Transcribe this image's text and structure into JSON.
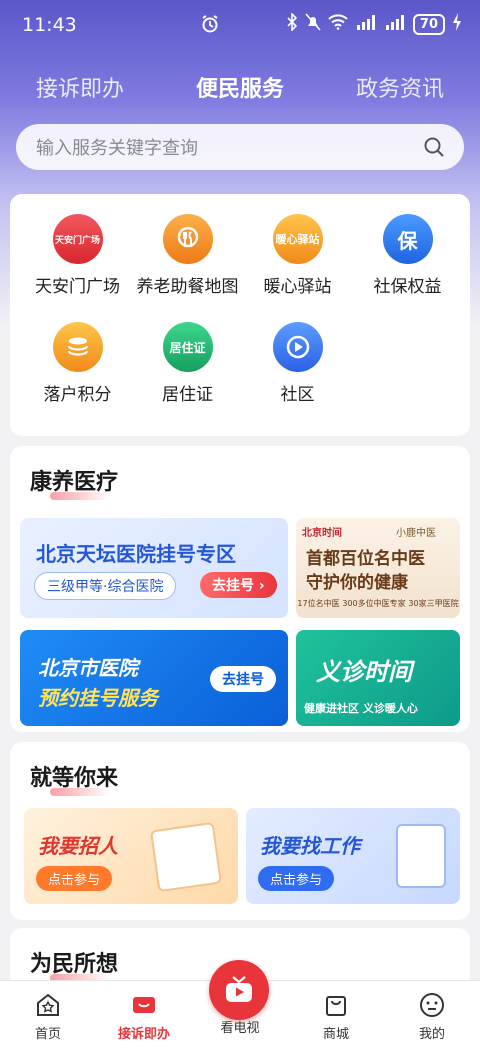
{
  "status": {
    "time": "11:43",
    "battery": "70"
  },
  "tabs": [
    {
      "label": "接诉即办"
    },
    {
      "label": "便民服务"
    },
    {
      "label": "政务资讯"
    }
  ],
  "search": {
    "placeholder": "输入服务关键字查询"
  },
  "services": [
    {
      "label": "天安门广场",
      "icon": "tiananmen-icon",
      "icon_text": "天安门广场",
      "color": "#e8353c"
    },
    {
      "label": "养老助餐地图",
      "icon": "meal-icon",
      "icon_text": "",
      "color": "#f08a24"
    },
    {
      "label": "暖心驿站",
      "icon": "warm-station-icon",
      "icon_text": "暖心驿站",
      "color": "#f5a623"
    },
    {
      "label": "社保权益",
      "icon": "insurance-icon",
      "icon_text": "保",
      "color": "#2f7ff0"
    },
    {
      "label": "落户积分",
      "icon": "points-icon",
      "icon_text": "",
      "color": "#f5a623"
    },
    {
      "label": "居住证",
      "icon": "residence-card-icon",
      "icon_text": "居住证",
      "color": "#22b573"
    },
    {
      "label": "社区",
      "icon": "community-icon",
      "icon_text": "",
      "color": "#3a7bf0"
    }
  ],
  "health": {
    "title": "康养医疗",
    "banner1": {
      "title": "北京天坛医院挂号专区",
      "subtitle": "三级甲等·综合医院",
      "button": "去挂号"
    },
    "banner2": {
      "brand": "北京时间",
      "partner": "小鹿中医",
      "line1": "首都百位名中医",
      "line2": "守护你的健康",
      "tags": [
        "17位名中医",
        "300多位中医专家",
        "30家三甲医院"
      ]
    },
    "banner3": {
      "line1": "北京市医院",
      "line2": "预约挂号服务",
      "button": "去挂号"
    },
    "banner4": {
      "title": "义诊时间",
      "subtitle": "健康进社区 义诊暖人心"
    }
  },
  "jobs": {
    "title": "就等你来",
    "banner1": {
      "title": "我要招人",
      "button": "点击参与"
    },
    "banner2": {
      "title": "我要找工作",
      "button": "点击参与"
    }
  },
  "people": {
    "title": "为民所想"
  },
  "nav": [
    {
      "label": "首页"
    },
    {
      "label": "接诉即办"
    },
    {
      "label": "看电视"
    },
    {
      "label": "商城"
    },
    {
      "label": "我的"
    }
  ]
}
